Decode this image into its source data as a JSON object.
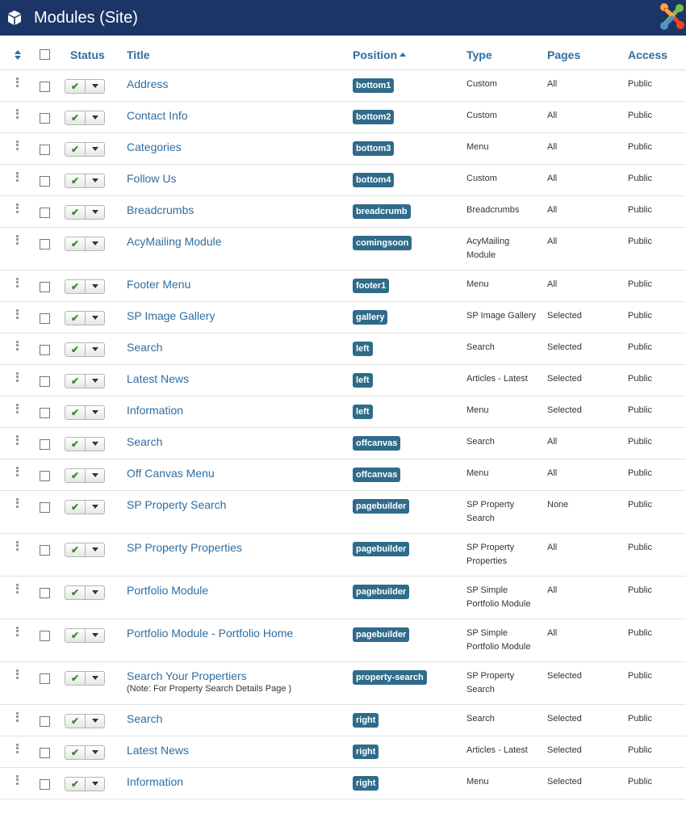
{
  "header": {
    "title": "Modules (Site)",
    "brand_color": "#1b3566"
  },
  "columns": {
    "status": "Status",
    "title": "Title",
    "position": "Position",
    "type": "Type",
    "pages": "Pages",
    "access": "Access"
  },
  "colors": {
    "link": "#2f6da0",
    "badge": "#2f6b8a",
    "check": "#3a8a2b"
  },
  "rows": [
    {
      "title": "Address",
      "position": "bottom1",
      "type": [
        "Custom"
      ],
      "pages": "All",
      "access": "Public"
    },
    {
      "title": "Contact Info",
      "position": "bottom2",
      "type": [
        "Custom"
      ],
      "pages": "All",
      "access": "Public"
    },
    {
      "title": "Categories",
      "position": "bottom3",
      "type": [
        "Menu"
      ],
      "pages": "All",
      "access": "Public"
    },
    {
      "title": "Follow Us",
      "position": "bottom4",
      "type": [
        "Custom"
      ],
      "pages": "All",
      "access": "Public"
    },
    {
      "title": "Breadcrumbs",
      "position": "breadcrumb",
      "type": [
        "Breadcrumbs"
      ],
      "pages": "All",
      "access": "Public"
    },
    {
      "title": "AcyMailing Module",
      "position": "comingsoon",
      "type": [
        "AcyMailing",
        "Module"
      ],
      "pages": "All",
      "access": "Public"
    },
    {
      "title": "Footer Menu",
      "position": "footer1",
      "type": [
        "Menu"
      ],
      "pages": "All",
      "access": "Public"
    },
    {
      "title": "SP Image Gallery",
      "position": "gallery",
      "type": [
        "SP Image Gallery"
      ],
      "pages": "Selected",
      "access": "Public"
    },
    {
      "title": "Search",
      "position": "left",
      "type": [
        "Search"
      ],
      "pages": "Selected",
      "access": "Public"
    },
    {
      "title": "Latest News",
      "position": "left",
      "type": [
        "Articles - Latest"
      ],
      "pages": "Selected",
      "access": "Public"
    },
    {
      "title": "Information",
      "position": "left",
      "type": [
        "Menu"
      ],
      "pages": "Selected",
      "access": "Public"
    },
    {
      "title": "Search",
      "position": "offcanvas",
      "type": [
        "Search"
      ],
      "pages": "All",
      "access": "Public"
    },
    {
      "title": "Off Canvas Menu",
      "position": "offcanvas",
      "type": [
        "Menu"
      ],
      "pages": "All",
      "access": "Public"
    },
    {
      "title": "SP Property Search",
      "position": "pagebuilder",
      "type": [
        "SP Property",
        "Search"
      ],
      "pages": "None",
      "access": "Public"
    },
    {
      "title": "SP Property Properties",
      "position": "pagebuilder",
      "type": [
        "SP Property",
        "Properties"
      ],
      "pages": "All",
      "access": "Public"
    },
    {
      "title": "Portfolio Module",
      "position": "pagebuilder",
      "type": [
        "SP Simple",
        "Portfolio Module"
      ],
      "pages": "All",
      "access": "Public"
    },
    {
      "title": "Portfolio Module - Portfolio Home",
      "position": "pagebuilder",
      "type": [
        "SP Simple",
        "Portfolio Module"
      ],
      "pages": "All",
      "access": "Public"
    },
    {
      "title": "Search Your Propertiers",
      "note": "(Note: For Property Search Details Page )",
      "position": "property-search",
      "type": [
        "SP Property",
        "Search"
      ],
      "pages": "Selected",
      "access": "Public"
    },
    {
      "title": "Search",
      "position": "right",
      "type": [
        "Search"
      ],
      "pages": "Selected",
      "access": "Public"
    },
    {
      "title": "Latest News",
      "position": "right",
      "type": [
        "Articles - Latest"
      ],
      "pages": "Selected",
      "access": "Public"
    },
    {
      "title": "Information",
      "position": "right",
      "type": [
        "Menu"
      ],
      "pages": "Selected",
      "access": "Public"
    }
  ]
}
